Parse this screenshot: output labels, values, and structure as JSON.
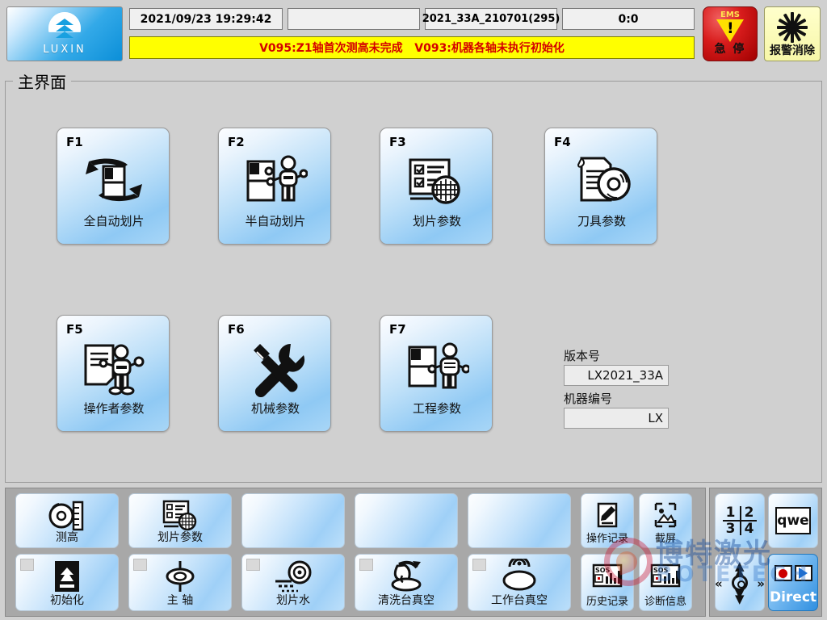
{
  "app": {
    "logo_text": "LUXIN",
    "page_title": "主界面"
  },
  "header": {
    "datetime": "2021/09/23 19:29:42",
    "blank_field": "",
    "recipe": "2021_33A_210701(295)",
    "counter": "0:0",
    "ems": {
      "top_label": "EMS",
      "label": "急 停"
    },
    "alarm_clear": {
      "label": "报警消除"
    },
    "alarm_message": "V095:Z1轴首次测高未完成   V093:机器各轴未执行初始化",
    "alarm_text_color": "#d40000",
    "alarm_bg_color": "#ffff00"
  },
  "main": {
    "tiles": [
      {
        "key": "F1",
        "label": "全自动划片",
        "icon": "auto-dicing-icon"
      },
      {
        "key": "F2",
        "label": "半自动划片",
        "icon": "semi-auto-dicing-icon"
      },
      {
        "key": "F3",
        "label": "划片参数",
        "icon": "dicing-params-icon"
      },
      {
        "key": "F4",
        "label": "刀具参数",
        "icon": "blade-params-icon"
      },
      {
        "key": "F5",
        "label": "操作者参数",
        "icon": "operator-params-icon"
      },
      {
        "key": "F6",
        "label": "机械参数",
        "icon": "wrench-screwdriver-icon"
      },
      {
        "key": "F7",
        "label": "工程参数",
        "icon": "engineer-params-icon"
      }
    ],
    "version": {
      "version_label": "版本号",
      "version_value": "LX2021_33A",
      "machine_label": "机器编号",
      "machine_value": "LX"
    }
  },
  "toolbar": {
    "row1": [
      {
        "label": "测高",
        "icon": "height-measure-icon",
        "lamp": false
      },
      {
        "label": "划片参数",
        "icon": "dicing-params-icon",
        "lamp": false
      },
      {
        "label": "",
        "icon": "",
        "lamp": false
      },
      {
        "label": "",
        "icon": "",
        "lamp": false
      },
      {
        "label": "",
        "icon": "",
        "lamp": false
      }
    ],
    "row2": [
      {
        "label": "初始化",
        "icon": "initialize-icon",
        "lamp": true
      },
      {
        "label": "主 轴",
        "icon": "spindle-icon",
        "lamp": true
      },
      {
        "label": "划片水",
        "icon": "dicing-water-icon",
        "lamp": true
      },
      {
        "label": "清洗台真空",
        "icon": "clean-table-vacuum-icon",
        "lamp": true
      },
      {
        "label": "工作台真空",
        "icon": "work-table-vacuum-icon",
        "lamp": true
      }
    ],
    "logs": [
      {
        "label": "操作记录",
        "icon": "pencil-note-icon"
      },
      {
        "label": "截屏",
        "icon": "screenshot-icon"
      },
      {
        "label": "历史记录",
        "icon": "sos-chart-icon"
      },
      {
        "label": "诊断信息",
        "icon": "sos-chart-icon"
      }
    ],
    "right_panel": [
      {
        "label": "",
        "icon": "numeric-keypad-icon",
        "value": [
          "1",
          "2",
          "3",
          "4"
        ]
      },
      {
        "label": "",
        "icon": "qwe-keyboard-icon",
        "value": "qwe"
      },
      {
        "label": "",
        "icon": "dpad-icon"
      },
      {
        "label": "Direct",
        "icon": "direct-record-play-icon",
        "active": true
      }
    ]
  },
  "watermark": {
    "cn": "博特激光",
    "en": "BOTETECH"
  }
}
